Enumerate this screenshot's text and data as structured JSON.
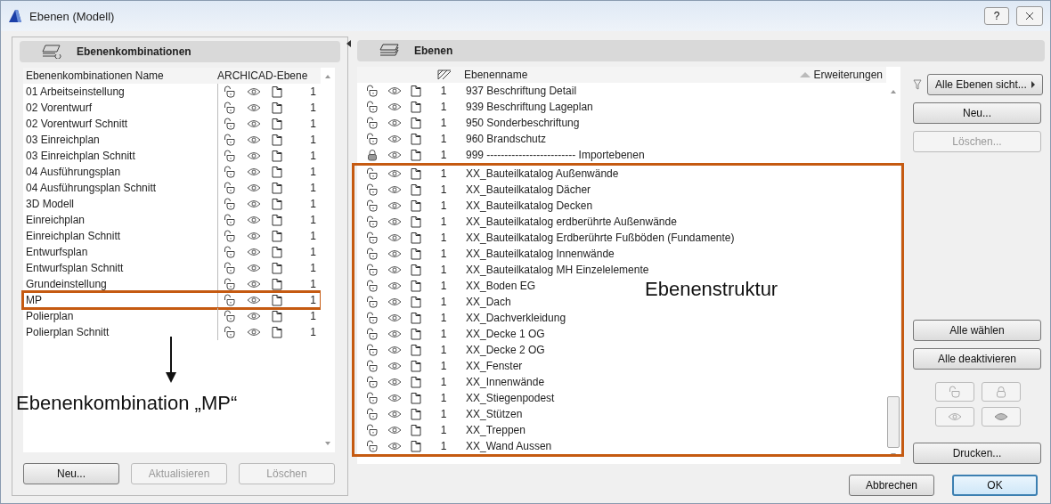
{
  "window": {
    "title": "Ebenen (Modell)",
    "help_button": "?"
  },
  "combinations": {
    "header": "Ebenenkombinationen",
    "columns": [
      "Ebenenkombinationen Name",
      "ARCHICAD-Ebene"
    ],
    "rows": [
      {
        "name": "01 Arbeitseinstellung",
        "locked": false,
        "count": "1",
        "highlighted": false
      },
      {
        "name": "02 Vorentwurf",
        "locked": false,
        "count": "1",
        "highlighted": false
      },
      {
        "name": "02 Vorentwurf Schnitt",
        "locked": false,
        "count": "1",
        "highlighted": false
      },
      {
        "name": "03 Einreichplan",
        "locked": false,
        "count": "1",
        "highlighted": false
      },
      {
        "name": "03 Einreichplan Schnitt",
        "locked": false,
        "count": "1",
        "highlighted": false
      },
      {
        "name": "04 Ausführungsplan",
        "locked": false,
        "count": "1",
        "highlighted": false
      },
      {
        "name": "04 Ausführungsplan Schnitt",
        "locked": false,
        "count": "1",
        "highlighted": false
      },
      {
        "name": "3D Modell",
        "locked": false,
        "count": "1",
        "highlighted": false
      },
      {
        "name": "Einreichplan",
        "locked": false,
        "count": "1",
        "highlighted": false
      },
      {
        "name": "Einreichplan Schnitt",
        "locked": false,
        "count": "1",
        "highlighted": false
      },
      {
        "name": "Entwurfsplan",
        "locked": false,
        "count": "1",
        "highlighted": false
      },
      {
        "name": "Entwurfsplan Schnitt",
        "locked": false,
        "count": "1",
        "highlighted": false
      },
      {
        "name": "Grundeinstellung",
        "locked": false,
        "count": "1",
        "highlighted": false
      },
      {
        "name": "MP",
        "locked": false,
        "count": "1",
        "highlighted": true
      },
      {
        "name": "Polierplan",
        "locked": false,
        "count": "1",
        "highlighted": false
      },
      {
        "name": "Polierplan Schnitt",
        "locked": false,
        "count": "1",
        "highlighted": false
      }
    ],
    "annotation": "Ebenenkombination „MP“",
    "buttons": [
      {
        "label": "Neu...",
        "disabled": false
      },
      {
        "label": "Aktualisieren",
        "disabled": true
      },
      {
        "label": "Löschen",
        "disabled": true
      }
    ]
  },
  "layers": {
    "header": "Ebenen",
    "columns": [
      "Ebenenname",
      "Erweiterungen"
    ],
    "rows": [
      {
        "name": "937 Beschriftung Detail",
        "locked": false,
        "count": "1"
      },
      {
        "name": "939 Beschriftung Lageplan",
        "locked": false,
        "count": "1"
      },
      {
        "name": "950 Sonderbeschriftung",
        "locked": false,
        "count": "1"
      },
      {
        "name": "960 Brandschutz",
        "locked": false,
        "count": "1"
      },
      {
        "name": "999 ------------------------- Importebenen",
        "locked": true,
        "count": "1"
      }
    ],
    "highlight_frame": {
      "annotation": "Ebenenstruktur",
      "rows": [
        {
          "name": "XX_Bauteilkatalog Außenwände",
          "locked": false,
          "count": "1"
        },
        {
          "name": "XX_Bauteilkatalog Dächer",
          "locked": false,
          "count": "1"
        },
        {
          "name": "XX_Bauteilkatalog Decken",
          "locked": false,
          "count": "1"
        },
        {
          "name": "XX_Bauteilkatalog erdberührte Außenwände",
          "locked": false,
          "count": "1"
        },
        {
          "name": "XX_Bauteilkatalog Erdberührte Fußböden (Fundamente)",
          "locked": false,
          "count": "1"
        },
        {
          "name": "XX_Bauteilkatalog Innenwände",
          "locked": false,
          "count": "1"
        },
        {
          "name": "XX_Bauteilkatalog MH Einzelelemente",
          "locked": false,
          "count": "1"
        },
        {
          "name": "XX_Boden EG",
          "locked": false,
          "count": "1"
        },
        {
          "name": "XX_Dach",
          "locked": false,
          "count": "1"
        },
        {
          "name": "XX_Dachverkleidung",
          "locked": false,
          "count": "1"
        },
        {
          "name": "XX_Decke 1 OG",
          "locked": false,
          "count": "1"
        },
        {
          "name": "XX_Decke 2 OG",
          "locked": false,
          "count": "1"
        },
        {
          "name": "XX_Fenster",
          "locked": false,
          "count": "1"
        },
        {
          "name": "XX_Innenwände",
          "locked": false,
          "count": "1"
        },
        {
          "name": "XX_Stiegenpodest",
          "locked": false,
          "count": "1"
        },
        {
          "name": "XX_Stützen",
          "locked": false,
          "count": "1"
        },
        {
          "name": "XX_Treppen",
          "locked": false,
          "count": "1"
        },
        {
          "name": "XX_Wand Aussen",
          "locked": false,
          "count": "1"
        }
      ]
    }
  },
  "filter_button": "Alle Ebenen sicht...",
  "side_buttons": [
    {
      "label": "Neu...",
      "disabled": false
    },
    {
      "label": "Löschen...",
      "disabled": true
    }
  ],
  "selection_buttons": [
    {
      "label": "Alle wählen",
      "disabled": false
    },
    {
      "label": "Alle deaktivieren",
      "disabled": false
    }
  ],
  "icon_buttons": [
    {
      "kind": "unlock",
      "disabled": true
    },
    {
      "kind": "lock",
      "disabled": true
    },
    {
      "kind": "show",
      "disabled": true
    },
    {
      "kind": "hide",
      "disabled": true
    }
  ],
  "print_button": {
    "label": "Drucken...",
    "disabled": false
  },
  "dialog_buttons": [
    {
      "label": "Abbrechen",
      "default": false
    },
    {
      "label": "OK",
      "default": true
    }
  ]
}
